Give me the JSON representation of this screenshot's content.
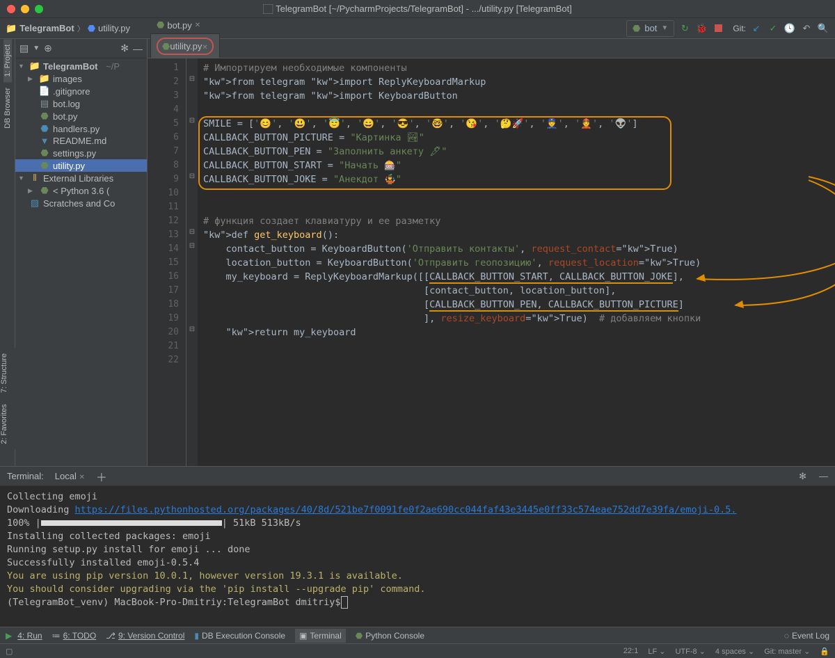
{
  "title": "TelegramBot [~/PycharmProjects/TelegramBot] - .../utility.py [TelegramBot]",
  "breadcrumb": {
    "project": "TelegramBot",
    "file": "utility.py"
  },
  "run_config": {
    "name": "bot"
  },
  "git_label": "Git:",
  "rails": {
    "project": "1: Project",
    "db": "DB Browser",
    "structure": "7: Structure",
    "favorites": "2: Favorites"
  },
  "tree": {
    "root": "TelegramBot",
    "root_path": "~/P",
    "items": [
      {
        "label": "images",
        "icon": "folder",
        "indent": 2,
        "arrow": "▶"
      },
      {
        "label": ".gitignore",
        "icon": "file",
        "indent": 2
      },
      {
        "label": "bot.log",
        "icon": "log",
        "indent": 2
      },
      {
        "label": "bot.py",
        "icon": "py",
        "indent": 2
      },
      {
        "label": "handlers.py",
        "icon": "py",
        "indent": 2,
        "accent": true
      },
      {
        "label": "README.md",
        "icon": "md",
        "indent": 2
      },
      {
        "label": "settings.py",
        "icon": "py",
        "indent": 2
      },
      {
        "label": "utility.py",
        "icon": "py",
        "indent": 2,
        "selected": true
      }
    ],
    "ext_lib": "External Libraries",
    "py_lib": "< Python 3.6 (",
    "scratches": "Scratches and Co"
  },
  "tabs": [
    {
      "label": "bot.py",
      "active": false
    },
    {
      "label": "utility.py",
      "active": true,
      "circled": true
    }
  ],
  "code_lines": [
    "# Импортируем необходимые компоненты",
    "from telegram import ReplyKeyboardMarkup",
    "from telegram import KeyboardButton",
    "",
    "SMILE = ['😊', '😃', '😇', '😄', '😎', '🤓', '😘', '🤔🚀', '👮', '👲', '👽']",
    "CALLBACK_BUTTON_PICTURE = \"Картинка 🏞\"",
    "CALLBACK_BUTTON_PEN = \"Заполнить анкету 🖋\"",
    "CALLBACK_BUTTON_START = \"Начать 🎰\"",
    "CALLBACK_BUTTON_JOKE = \"Анекдот 🤹\"",
    "",
    "",
    "# функция создает клавиатуру и ее разметку",
    "def get_keyboard():",
    "    contact_button = KeyboardButton('Отправить контакты', request_contact=True)",
    "    location_button = KeyboardButton('Отправить геопозицию', request_location=True)",
    "    my_keyboard = ReplyKeyboardMarkup([[CALLBACK_BUTTON_START, CALLBACK_BUTTON_JOKE],",
    "                                       [contact_button, location_button],",
    "                                       [CALLBACK_BUTTON_PEN, CALLBACK_BUTTON_PICTURE]",
    "                                       ], resize_keyboard=True)  # добавляем кнопки",
    "    return my_keyboard",
    "",
    ""
  ],
  "terminal": {
    "title": "Terminal:",
    "tab": "Local",
    "lines": {
      "l1": "Collecting emoji",
      "l2a": "  Downloading ",
      "l2b": "https://files.pythonhosted.org/packages/40/8d/521be7f0091fe0f2ae690cc044faf43e3445e0ff33c574eae752dd7e39fa/emoji-0.5.",
      "l3a": "    100% |",
      "l3b": "| 51kB 513kB/s",
      "l4": "Installing collected packages: emoji",
      "l5": "  Running setup.py install for emoji ... done",
      "l6": "Successfully installed emoji-0.5.4",
      "l7": "You are using pip version 10.0.1, however version 19.3.1 is available.",
      "l8": "You should consider upgrading via the 'pip install --upgrade pip' command.",
      "l9": "(TelegramBot_venv) MacBook-Pro-Dmitriy:TelegramBot dmitriy$ "
    }
  },
  "bottom_bar": {
    "run": "4: Run",
    "todo": "6: TODO",
    "vcs": "9: Version Control",
    "db": "DB Execution Console",
    "terminal": "Terminal",
    "pyconsole": "Python Console",
    "eventlog": "Event Log"
  },
  "status": {
    "pos": "22:1",
    "lf": "LF",
    "enc": "UTF-8",
    "indent": "4 spaces",
    "git": "Git: master"
  }
}
